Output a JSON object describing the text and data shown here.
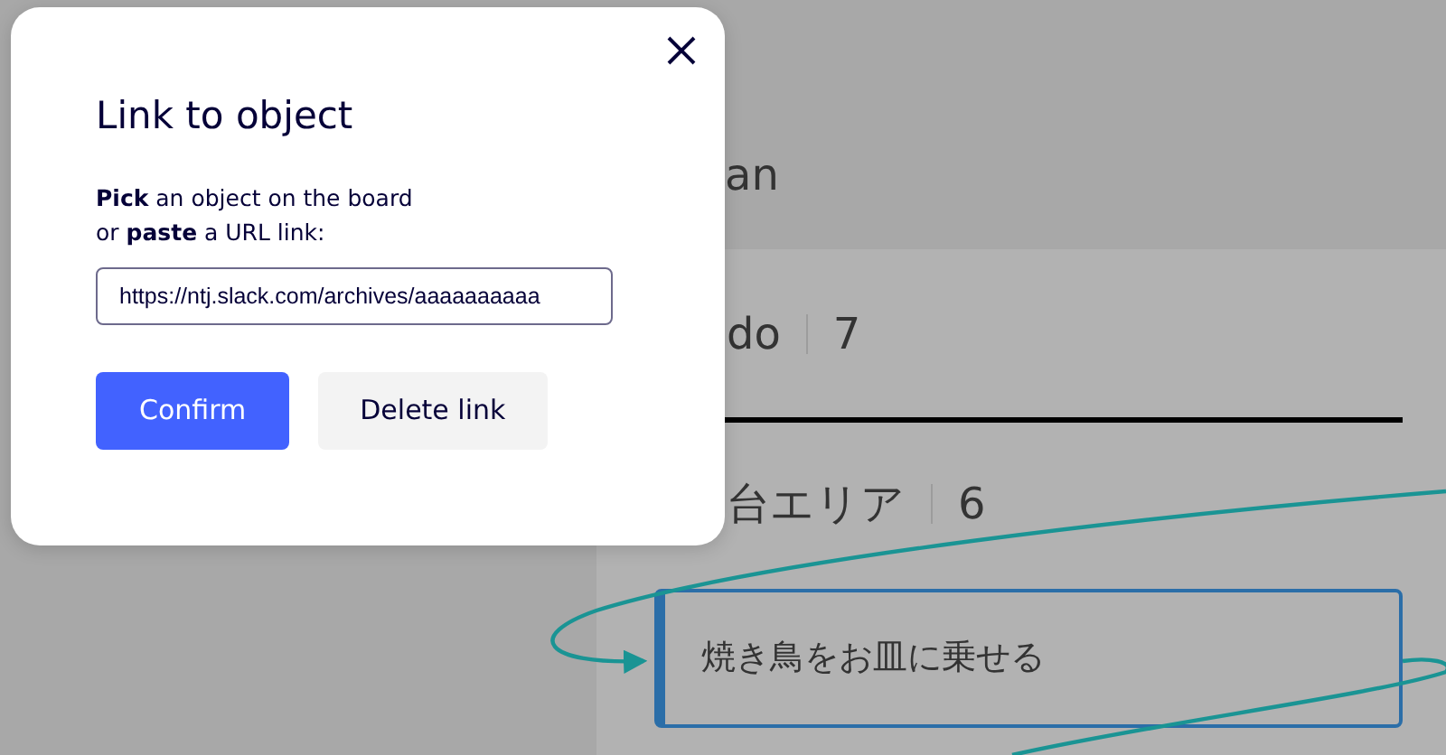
{
  "board": {
    "heading": "an",
    "sections": [
      {
        "title": "do",
        "count": "7"
      },
      {
        "title": "台エリア",
        "count": "6",
        "cards": [
          {
            "text": "焼き鳥をお皿に乗せる",
            "color": "#2b6ea8"
          }
        ]
      }
    ]
  },
  "dialog": {
    "title": "Link to object",
    "description": "**Pick** an object on the board",
    "description_2": "or **paste** a URL link:",
    "url_field": {
      "value": "https://ntj.slack.com/archives/aaaaaaaaaa"
    },
    "buttons": [
      {
        "label": "Confirm",
        "kind": "primary"
      },
      {
        "label": "Delete link",
        "kind": "secondary"
      }
    ]
  }
}
